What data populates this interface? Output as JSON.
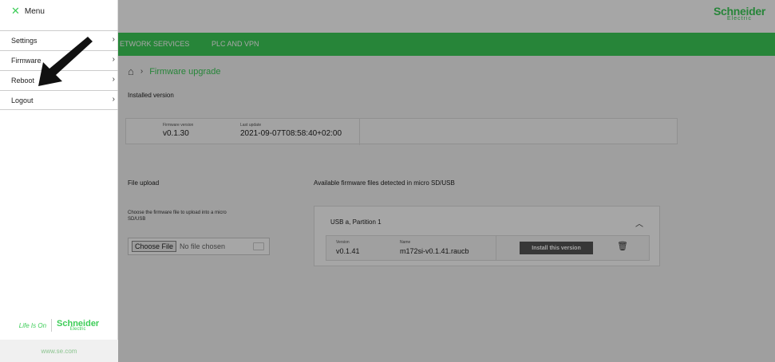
{
  "brand": {
    "name": "Schneider",
    "sub": "Electric"
  },
  "nav": {
    "items": [
      "ETWORK SERVICES",
      "PLC AND VPN"
    ]
  },
  "breadcrumb": {
    "page": "Firmware upgrade"
  },
  "installed": {
    "heading": "Installed version",
    "version_label": "Firmware version",
    "version_value": "v0.1.30",
    "update_label": "Last update",
    "update_value": "2021-09-07T08:58:40+02:00"
  },
  "upload": {
    "heading": "File upload",
    "description": "Choose the firmware file to upload into a micro SD/USB",
    "choose_label": "Choose File",
    "no_file_text": "No file chosen"
  },
  "available": {
    "heading": "Available firmware files detected in micro SD/USB",
    "partition_title": "USB a, Partition 1",
    "version_label": "Version",
    "version_value": "v0.1.41",
    "name_label": "Name",
    "name_value": "m172si-v0.1.41.raucb",
    "install_label": "Install this version"
  },
  "menu": {
    "title": "Menu",
    "items": [
      {
        "label": "Settings"
      },
      {
        "label": "Firmware"
      },
      {
        "label": "Reboot"
      },
      {
        "label": "Logout"
      }
    ],
    "life_is_on": "Life Is On",
    "footer_url": "www.se.com"
  },
  "colors": {
    "accent": "#3dcd58",
    "overlay": "rgba(0,0,0,0.35)"
  },
  "icons": {
    "close": "close-icon",
    "chevron": "chevron-right-icon",
    "home": "home-icon",
    "trash": "trash-icon",
    "arrow": "pointer-arrow"
  }
}
